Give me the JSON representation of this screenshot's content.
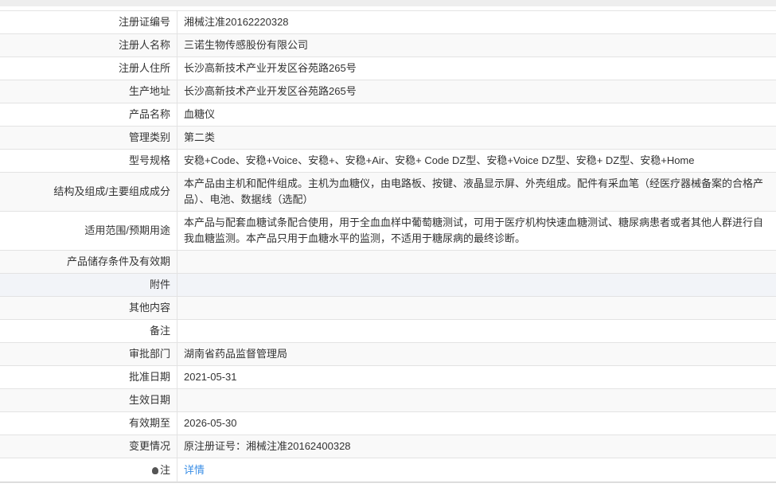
{
  "rows": [
    {
      "label": "注册证编号",
      "value": "湘械注准20162220328"
    },
    {
      "label": "注册人名称",
      "value": "三诺生物传感股份有限公司"
    },
    {
      "label": "注册人住所",
      "value": "长沙高新技术产业开发区谷苑路265号"
    },
    {
      "label": "生产地址",
      "value": "长沙高新技术产业开发区谷苑路265号"
    },
    {
      "label": "产品名称",
      "value": "血糖仪"
    },
    {
      "label": "管理类别",
      "value": "第二类"
    },
    {
      "label": "型号规格",
      "value": "安稳+Code、安稳+Voice、安稳+、安稳+Air、安稳+ Code DZ型、安稳+Voice DZ型、安稳+ DZ型、安稳+Home"
    },
    {
      "label": "结构及组成/主要组成成分",
      "value": "本产品由主机和配件组成。主机为血糖仪，由电路板、按键、液晶显示屏、外壳组成。配件有采血笔（经医疗器械备案的合格产品）、电池、数据线（选配）"
    },
    {
      "label": "适用范围/预期用途",
      "value": "本产品与配套血糖试条配合使用，用于全血血样中葡萄糖测试，可用于医疗机构快速血糖测试、糖尿病患者或者其他人群进行自我血糖监测。本产品只用于血糖水平的监测，不适用于糖尿病的最终诊断。"
    },
    {
      "label": "产品储存条件及有效期",
      "value": ""
    },
    {
      "label": "附件",
      "value": ""
    },
    {
      "label": "其他内容",
      "value": ""
    },
    {
      "label": "备注",
      "value": ""
    },
    {
      "label": "审批部门",
      "value": "湖南省药品监督管理局"
    },
    {
      "label": "批准日期",
      "value": "2021-05-31"
    },
    {
      "label": "生效日期",
      "value": ""
    },
    {
      "label": "有效期至",
      "value": "2026-05-30"
    },
    {
      "label": "变更情况",
      "value": "原注册证号：湘械注准20162400328"
    }
  ],
  "note": {
    "label": "注",
    "link": "详情"
  }
}
